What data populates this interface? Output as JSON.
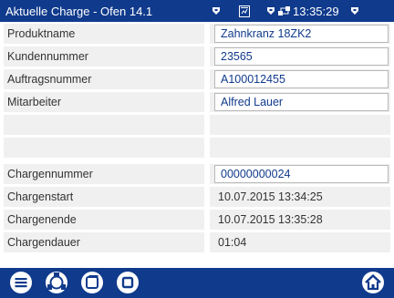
{
  "window": {
    "title": "Aktuelle Charge - Ofen 14.1"
  },
  "status": {
    "time": "13:35:29"
  },
  "fields": [
    {
      "label": "Produktname",
      "value": "Zahnkranz 18ZK2"
    },
    {
      "label": "Kundennummer",
      "value": "23565"
    },
    {
      "label": "Auftragsnummer",
      "value": "A100012455"
    },
    {
      "label": "Mitarbeiter",
      "value": "Alfred Lauer"
    }
  ],
  "batch": [
    {
      "label": "Chargennummer",
      "value": "00000000024"
    },
    {
      "label": "Chargenstart",
      "value": "10.07.2015 13:34:25"
    },
    {
      "label": "Chargenende",
      "value": "10.07.2015 13:35:28"
    },
    {
      "label": "Chargendauer",
      "value": "01:04"
    }
  ],
  "icons": {
    "status": [
      "marker-icon",
      "document-icon",
      "marker-icon",
      "network-icon",
      "marker-icon"
    ],
    "toolbar": [
      "list-icon",
      "group-icon",
      "window-icon",
      "stop-icon",
      "home-icon"
    ]
  },
  "colors": {
    "header": "#103a8c",
    "row_bg": "#f0f0f0",
    "value_text": "#103a8c"
  }
}
